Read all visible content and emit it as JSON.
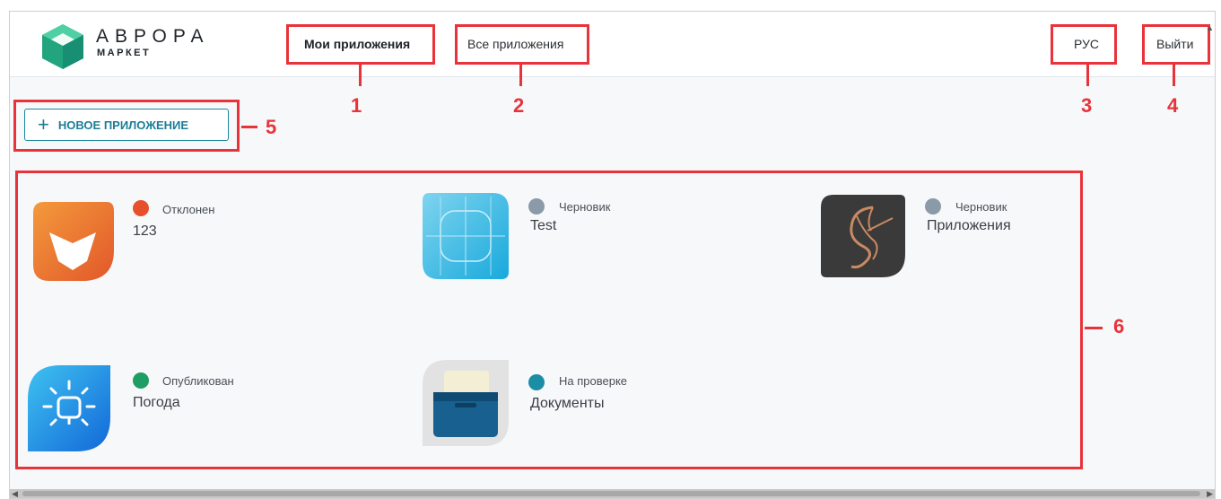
{
  "logo": {
    "title": "АВРОРА",
    "subtitle": "МАРКЕТ"
  },
  "nav": {
    "my_apps": "Мои приложения",
    "all_apps": "Все приложения",
    "language": "РУС",
    "logout": "Выйти"
  },
  "actions": {
    "new_app": "НОВОЕ ПРИЛОЖЕНИЕ"
  },
  "annotations": [
    "1",
    "2",
    "3",
    "4",
    "5",
    "6"
  ],
  "status_colors": {
    "rejected": "#e6502d",
    "draft": "#8a9aa8",
    "published": "#1e9e64",
    "review": "#1b8ea6"
  },
  "apps": [
    {
      "name": "123",
      "status": "Отклонен",
      "status_key": "rejected",
      "icon": "aptoide-icon"
    },
    {
      "name": "Test",
      "status": "Черновик",
      "status_key": "draft",
      "icon": "test-app-icon"
    },
    {
      "name": "Приложения",
      "status": "Черновик",
      "status_key": "draft",
      "icon": "s-logo-icon"
    },
    {
      "name": "Погода",
      "status": "Опубликован",
      "status_key": "published",
      "icon": "weather-icon"
    },
    {
      "name": "Документы",
      "status": "На проверке",
      "status_key": "review",
      "icon": "documents-icon"
    }
  ]
}
